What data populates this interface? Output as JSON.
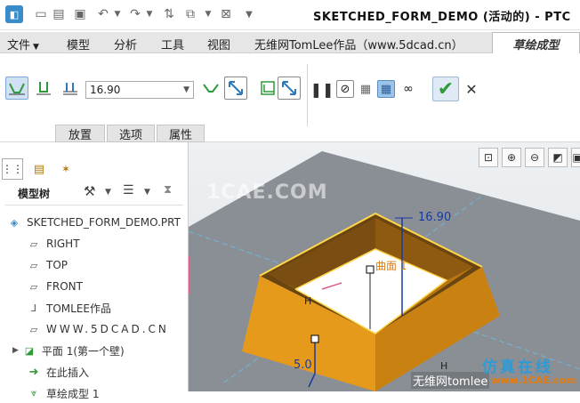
{
  "window_title": "SKETCHED_FORM_DEMO (活动的) - PTC",
  "menu": {
    "file": "文件",
    "model": "模型",
    "analysis": "分析",
    "tools": "工具",
    "view": "视图",
    "author": "无维网TomLee作品（www.5dcad.cn）",
    "active_tab": "草绘成型"
  },
  "ribbon": {
    "thickness_value": "16.90",
    "bottom_tabs": [
      "放置",
      "选项",
      "属性"
    ]
  },
  "tree": {
    "header": "模型树",
    "items": [
      {
        "label": "SKETCHED_FORM_DEMO.PRT",
        "icon": "part-icon"
      },
      {
        "label": "RIGHT",
        "icon": "datum-plane-icon"
      },
      {
        "label": "TOP",
        "icon": "datum-plane-icon"
      },
      {
        "label": "FRONT",
        "icon": "datum-plane-icon"
      },
      {
        "label": "TOMLEE作品",
        "icon": "coordinate-system-icon"
      },
      {
        "label": "WWW.5DCAD.CN",
        "icon": "datum-plane-icon"
      },
      {
        "label": "平面 1(第一个壁)",
        "icon": "sheet-wall-icon"
      },
      {
        "label": "在此插入",
        "icon": "insert-arrow-icon"
      },
      {
        "label": "草绘成型 1",
        "icon": "form-icon"
      }
    ]
  },
  "viewport": {
    "dim_top": "16.90",
    "dim_bottom": "5.0",
    "surface_label": "曲面 1",
    "label_h1": "H",
    "label_h2": "H",
    "watermark1": "1CAE.COM",
    "watermark2": "无维网tomlee",
    "watermark3": "仿真在线",
    "watermark4": "www.1CAE.com"
  },
  "colors": {
    "accent_green": "#2e9a3a",
    "model_orange": "#d98a10",
    "dim_blue": "#1a3aa0"
  }
}
